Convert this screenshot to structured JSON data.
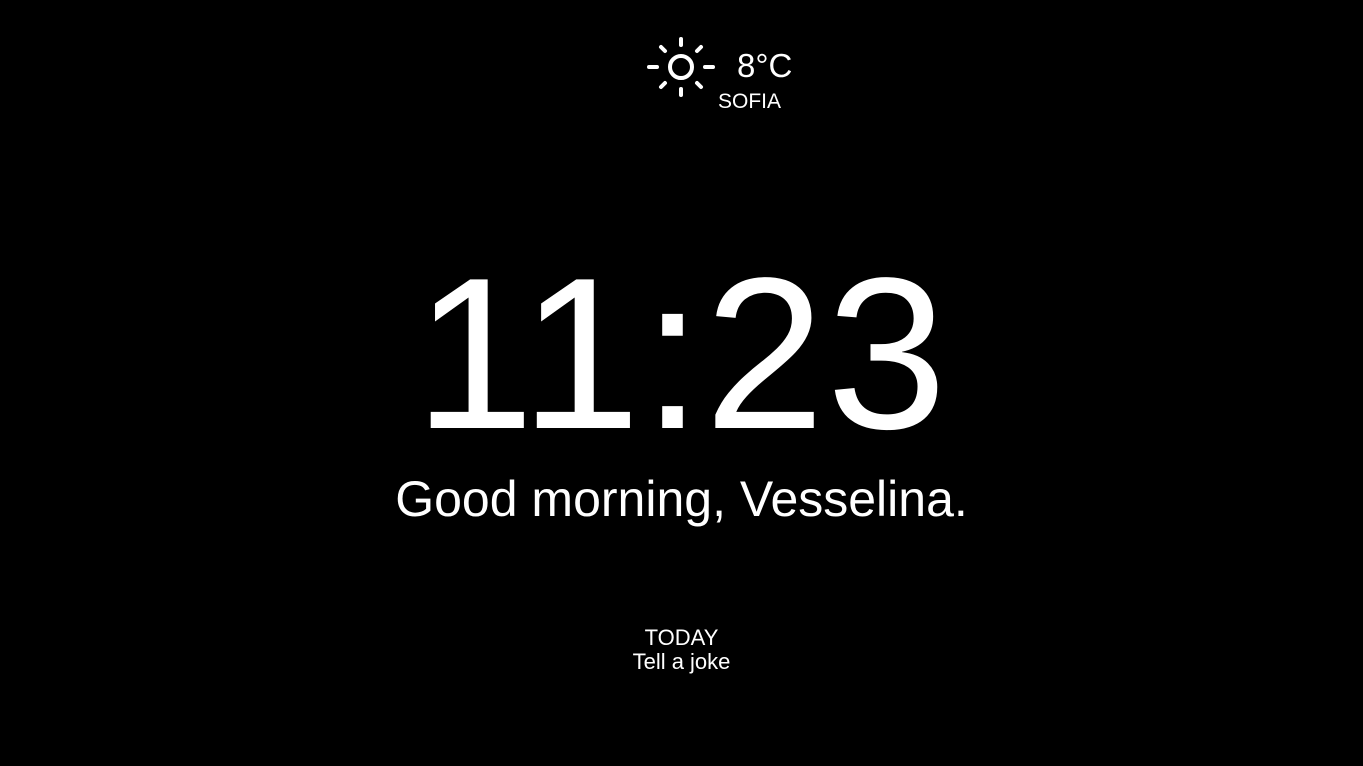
{
  "weather": {
    "icon": "sun-icon",
    "temperature": "8°C",
    "city": "SOFIA"
  },
  "clock": {
    "time": "11:23"
  },
  "greeting": {
    "text": "Good morning, Vesselina."
  },
  "today": {
    "title": "TODAY",
    "items": [
      "Tell a joke"
    ]
  },
  "colors": {
    "background": "#000000",
    "foreground": "#ffffff"
  }
}
